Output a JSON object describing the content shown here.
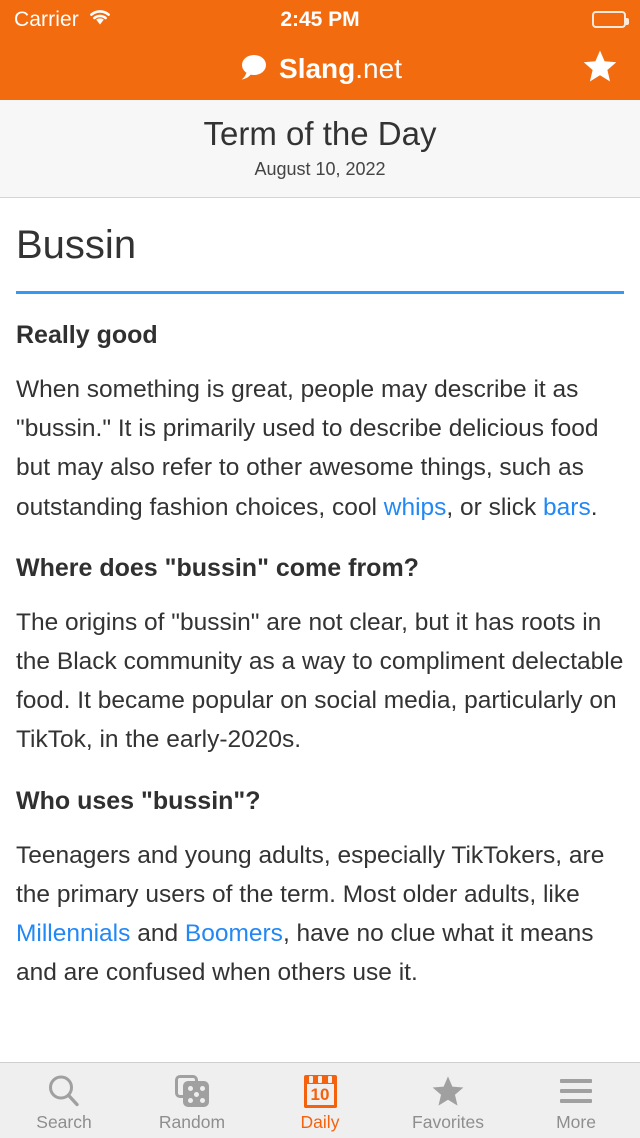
{
  "status_bar": {
    "carrier": "Carrier",
    "time": "2:45 PM",
    "wifi_icon": "wifi-icon",
    "battery_icon": "battery-full-icon"
  },
  "nav_bar": {
    "brand_bold": "Slang",
    "brand_light": ".net",
    "logo_icon": "speech-bubble-icon",
    "favorite_icon": "star-icon"
  },
  "page_header": {
    "title": "Term of the Day",
    "date": "August 10, 2022"
  },
  "article": {
    "term": "Bussin",
    "sections": [
      {
        "heading": "Really good",
        "paragraph_parts": [
          {
            "type": "text",
            "text": "When something is great, people may describe it as \"bussin.\" It is primarily used to describe delicious food but may also refer to other awesome things, such as outstanding fashion choices, cool "
          },
          {
            "type": "link",
            "text": "whips"
          },
          {
            "type": "text",
            "text": ", or slick "
          },
          {
            "type": "link",
            "text": "bars"
          },
          {
            "type": "text",
            "text": "."
          }
        ]
      },
      {
        "heading": "Where does \"bussin\" come from?",
        "paragraph_parts": [
          {
            "type": "text",
            "text": "The origins of \"bussin\" are not clear, but it has roots in the Black community as a way to compliment delectable food. It became popular on social media, particularly on TikTok, in the early-2020s."
          }
        ]
      },
      {
        "heading": "Who uses \"bussin\"?",
        "paragraph_parts": [
          {
            "type": "text",
            "text": "Teenagers and young adults, especially TikTokers, are the primary users of the term. Most older adults, like "
          },
          {
            "type": "link",
            "text": "Millennials"
          },
          {
            "type": "text",
            "text": " and "
          },
          {
            "type": "link",
            "text": "Boomers"
          },
          {
            "type": "text",
            "text": ", have no clue what it means and are confused when others use it."
          }
        ]
      }
    ]
  },
  "tab_bar": {
    "active_index": 2,
    "tabs": [
      {
        "label": "Search",
        "icon": "search-icon"
      },
      {
        "label": "Random",
        "icon": "dice-icon"
      },
      {
        "label": "Daily",
        "icon": "calendar-icon",
        "badge": "10"
      },
      {
        "label": "Favorites",
        "icon": "star-icon"
      },
      {
        "label": "More",
        "icon": "hamburger-icon"
      }
    ]
  },
  "colors": {
    "brand_orange": "#f26b0f",
    "accent_orange": "#f4620d",
    "link_blue": "#2288f5",
    "rule_blue": "#3498f5",
    "tab_inactive": "#8e8e8e"
  }
}
